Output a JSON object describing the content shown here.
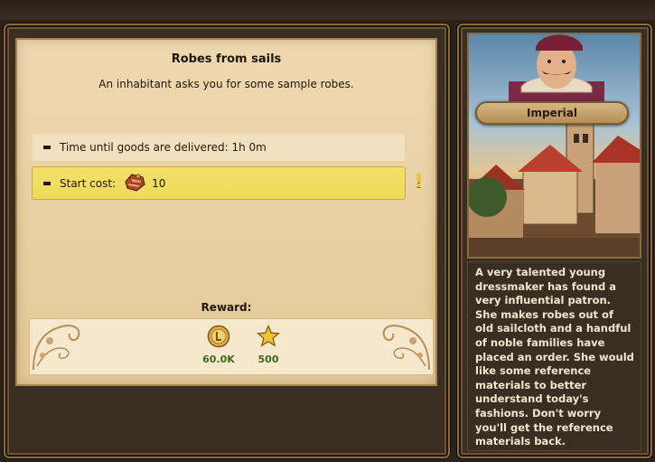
{
  "quest": {
    "title": "Robes from sails",
    "subtitle": "An inhabitant asks you for some sample robes.",
    "requirements": {
      "time": "Time until goods are delivered: 1h 0m",
      "cost_label": "Start cost:",
      "cost_value": "10",
      "cost_icon": "cloth-goods-icon",
      "warning": "!"
    },
    "reward_label": "Reward:",
    "rewards": [
      {
        "icon": "coin-icon",
        "value": "60.0K"
      },
      {
        "icon": "star-icon",
        "value": "500"
      }
    ]
  },
  "character": {
    "name": "Imperial",
    "description": "A very talented young dressmaker has found a very influential patron. She makes robes out of old sailcloth and a handful of noble families have placed an order. She would like some reference materials to better understand today's fashions. Don't worry you'll get the reference materials back."
  },
  "colors": {
    "cost_highlight": "#eedb5a",
    "reward_value": "#3d6a1c",
    "warning": "#e8c81c"
  }
}
